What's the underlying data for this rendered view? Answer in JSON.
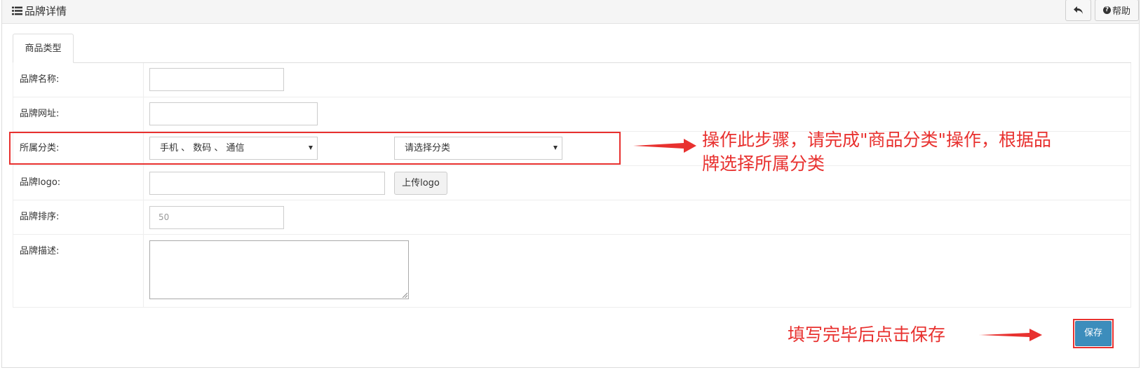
{
  "header": {
    "title": "品牌详情",
    "back_icon": "reply-icon",
    "help_label": "帮助",
    "help_icon": "question-circle-icon"
  },
  "tabs": [
    {
      "label": "商品类型",
      "active": true
    }
  ],
  "form": {
    "name": {
      "label": "品牌名称:",
      "value": ""
    },
    "url": {
      "label": "品牌网址:",
      "value": ""
    },
    "category": {
      "label": "所属分类:",
      "primary_selected": "手机 、 数码 、 通信",
      "secondary_selected": "请选择分类"
    },
    "logo": {
      "label": "品牌logo:",
      "value": "",
      "upload_label": "上传logo"
    },
    "sort": {
      "label": "品牌排序:",
      "placeholder": "50"
    },
    "description": {
      "label": "品牌描述:",
      "value": ""
    }
  },
  "annotations": {
    "category_note_line1": "操作此步骤，请完成\"商品分类\"操作，根据品",
    "category_note_line2": "牌选择所属分类",
    "save_note": "填写完毕后点击保存"
  },
  "save_label": "保存",
  "colors": {
    "annotation_red": "#e8312f",
    "primary_blue": "#3c8dbc"
  }
}
